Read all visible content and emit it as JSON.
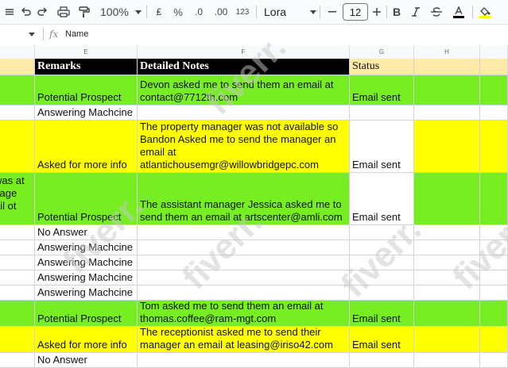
{
  "toolbar": {
    "zoom": "100%",
    "currency": "₤",
    "percent": "%",
    "decrease_decimal": ".0",
    "increase_decimal": ".00",
    "number_format": "123",
    "font": "Lora",
    "font_size": "12",
    "bold": "B"
  },
  "formula_bar": {
    "fx": "fx",
    "value": "Name"
  },
  "columns": [
    "E",
    "F",
    "G",
    "H"
  ],
  "header_row": {
    "remarks": "Remarks",
    "notes": "Detailed Notes",
    "status": "Status"
  },
  "rows": [
    {
      "left": "",
      "remarks": "Potential Prospect",
      "notes": "Devon asked me to send them an email at contact@7712th.com",
      "status": "Email sent",
      "fill": "green"
    },
    {
      "left": "",
      "remarks": "Answering Machcine",
      "notes": "",
      "status": "",
      "fill": "white"
    },
    {
      "left": "",
      "remarks": "Asked for more info",
      "notes": "The property manager was not available so Bandon Asked me to send the manager an email at atlantichousemgr@willowbridgepc.com",
      "status": "Email sent",
      "fill": "yellow"
    },
    {
      "left": "was at\nsage\nail ot",
      "remarks": "Potential Prospect",
      "notes": "The assistant manager Jessica asked me to send them an email at artscenter@amli.com",
      "status": "Email sent",
      "fill": "green"
    },
    {
      "left": "",
      "remarks": "No Answer",
      "notes": "",
      "status": "",
      "fill": "white"
    },
    {
      "left": "",
      "remarks": "Answering Machcine",
      "notes": "",
      "status": "",
      "fill": "white"
    },
    {
      "left": "",
      "remarks": "Answering Machcine",
      "notes": "",
      "status": "",
      "fill": "white"
    },
    {
      "left": "",
      "remarks": "Answering Machcine",
      "notes": "",
      "status": "",
      "fill": "white"
    },
    {
      "left": "",
      "remarks": "Answering Machcine",
      "notes": "",
      "status": "",
      "fill": "white"
    },
    {
      "left": "",
      "remarks": "Potential Prospect",
      "notes": "Tom asked me to send them an email at thomas.coffee@ram-mgt.com",
      "status": "Email sent",
      "fill": "green"
    },
    {
      "left": "",
      "remarks": "Asked for more info",
      "notes": "The receptionist asked me to send their manager an email at leasing@iriso42.com",
      "status": "Email sent",
      "fill": "yellow"
    },
    {
      "left": "",
      "remarks": "No Answer",
      "notes": "",
      "status": "",
      "fill": "white"
    }
  ],
  "colors": {
    "green": "#77ee22",
    "yellow": "#ffff00",
    "white": "#ffffff",
    "header_bg": "#000000",
    "header_yellow": "#fde9a8"
  }
}
